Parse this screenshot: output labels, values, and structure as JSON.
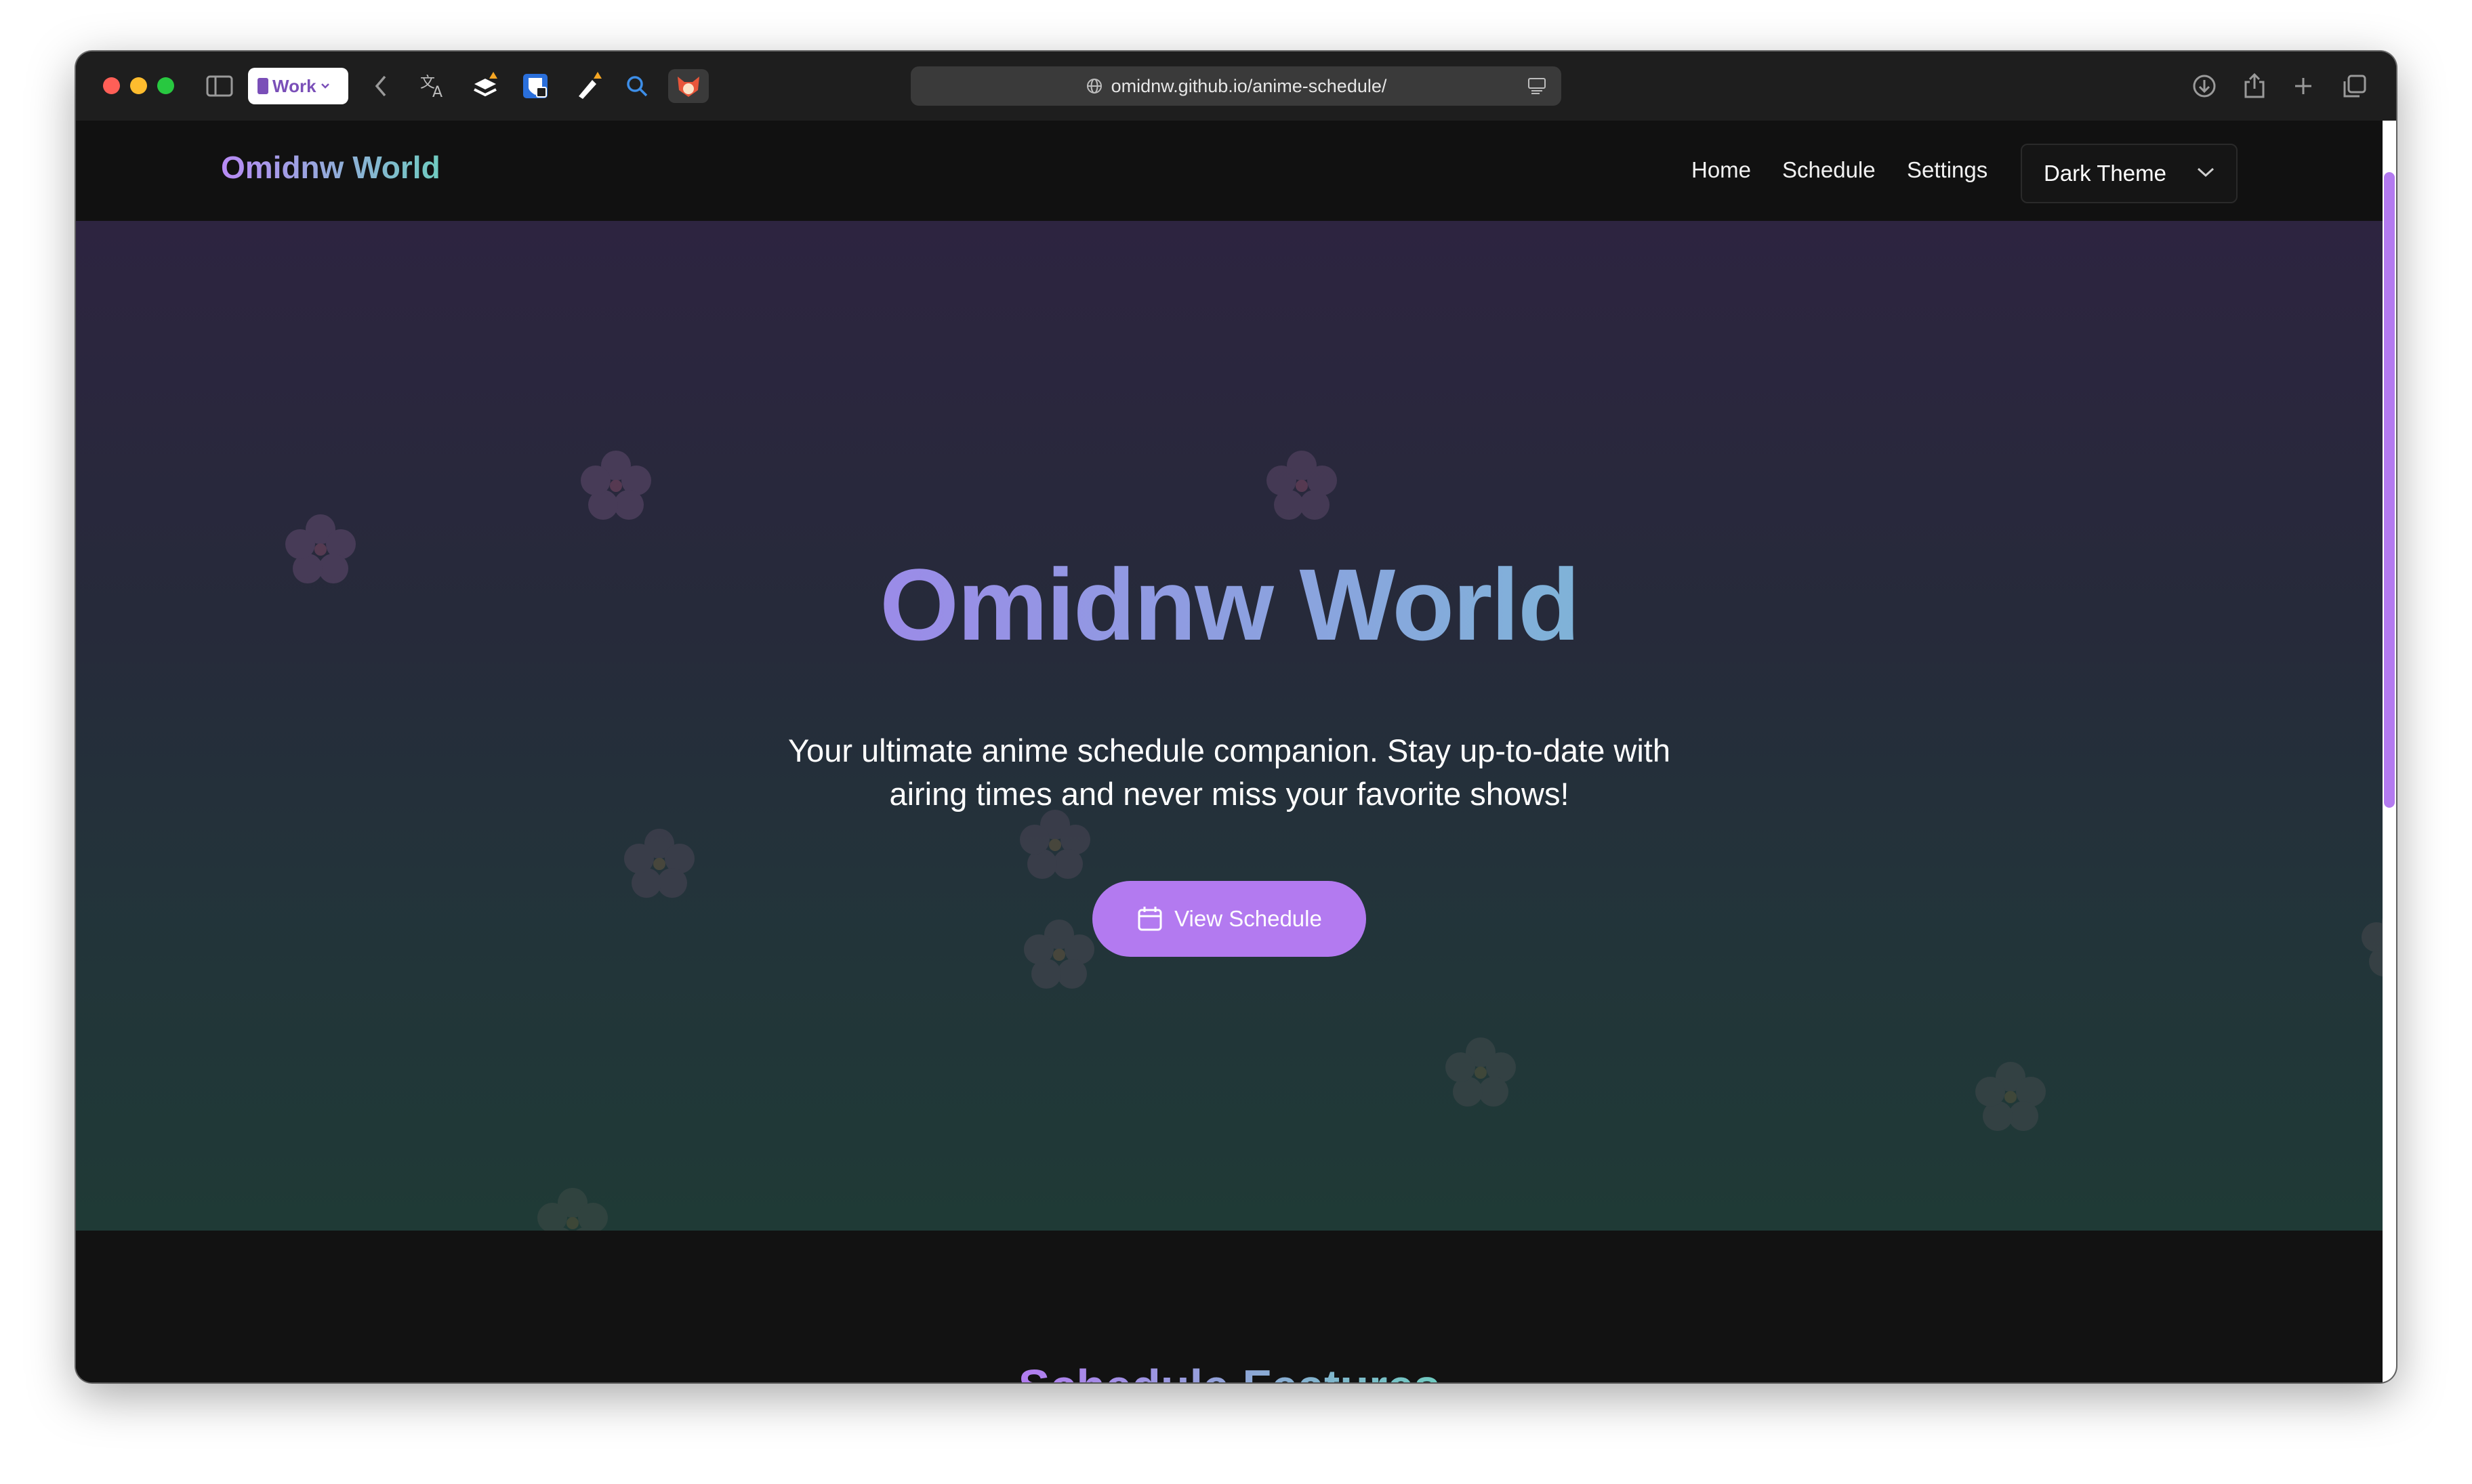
{
  "browser": {
    "profile_label": "Work",
    "url": "omidnw.github.io/anime-schedule/",
    "toolbar_icons": [
      "sidebar-icon",
      "back-icon",
      "translate-icon",
      "layers-extension-icon",
      "bitwarden-icon",
      "marker-icon",
      "search-icon",
      "fox-extension-icon",
      "download-icon",
      "share-icon",
      "new-tab-icon",
      "tab-overview-icon"
    ]
  },
  "nav": {
    "brand": "Omidnw World",
    "links": [
      "Home",
      "Schedule",
      "Settings"
    ],
    "theme_select": "Dark Theme"
  },
  "hero": {
    "title": "Omidnw World",
    "subtitle_line1": "Your ultimate anime schedule companion. Stay up-to-date with",
    "subtitle_line2": "airing times and never miss your favorite shows!",
    "cta_label": "View Schedule",
    "cta_icon": "calendar-icon"
  },
  "features": {
    "title": "Schedule Features"
  },
  "colors": {
    "accent": "#b37af0",
    "brand_gradient_start": "#b88af5",
    "brand_gradient_end": "#6fcbc0",
    "nav_bg": "#111111",
    "hero_top": "#2d2440",
    "hero_bottom": "#1f3a36"
  }
}
